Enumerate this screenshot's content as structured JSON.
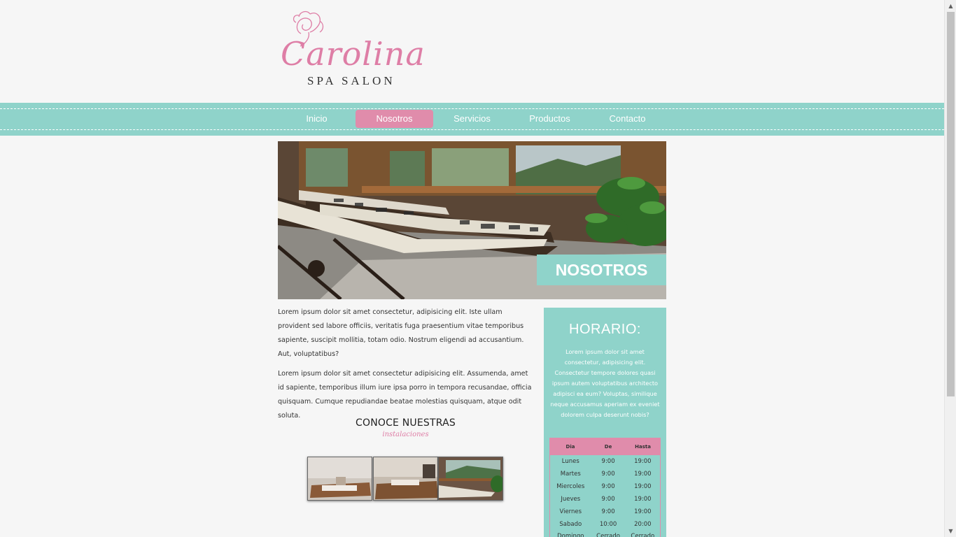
{
  "brand": {
    "name": "Carolina",
    "subtitle": "SPA SALON",
    "accent": "#de7ea6",
    "teal": "#8fd3ca",
    "pink": "#e08cab"
  },
  "nav": [
    {
      "label": "Inicio",
      "active": false
    },
    {
      "label": "Nosotros",
      "active": true
    },
    {
      "label": "Servicios",
      "active": false
    },
    {
      "label": "Productos",
      "active": false
    },
    {
      "label": "Contacto",
      "active": false
    }
  ],
  "hero": {
    "title": "NOSOTROS"
  },
  "content": {
    "p1": "Lorem ipsum dolor sit amet consectetur, adipisicing elit. Iste ullam provident sed labore officiis, veritatis fuga praesentium vitae temporibus sapiente, suscipit mollitia, totam odio. Nostrum eligendi ad accusantium. Aut, voluptatibus?",
    "p2": "Lorem ipsum dolor sit amet consectetur adipisicing elit. Assumenda, amet id sapiente, temporibus illum iure ipsa porro in tempora recusandae, officia quisquam. Cumque repudiandae beatae molestias quisquam, atque odit soluta.",
    "conoce_title": "CONOCE NUESTRAS",
    "conoce_sub": "instalaciones"
  },
  "sidebar": {
    "title": "HORARIO:",
    "text": "Lorem ipsum dolor sit amet consectetur, adipisicing elit. Consectetur tempore dolores quasi ipsum autem voluptatibus architecto adipisci ea eum? Voluptas, similique neque accusamus aperiam ex eveniet dolorem culpa deserunt nobis?",
    "headers": [
      "Dia",
      "De",
      "Hasta"
    ],
    "rows": [
      [
        "Lunes",
        "9:00",
        "19:00"
      ],
      [
        "Martes",
        "9:00",
        "19:00"
      ],
      [
        "Miercoles",
        "9:00",
        "19:00"
      ],
      [
        "Jueves",
        "9:00",
        "19:00"
      ],
      [
        "Viernes",
        "9:00",
        "19:00"
      ],
      [
        "Sabado",
        "10:00",
        "20:00"
      ],
      [
        "Domingo",
        "Cerrado",
        "Cerrado"
      ]
    ]
  },
  "icons": {
    "logo": "rose-icon"
  }
}
